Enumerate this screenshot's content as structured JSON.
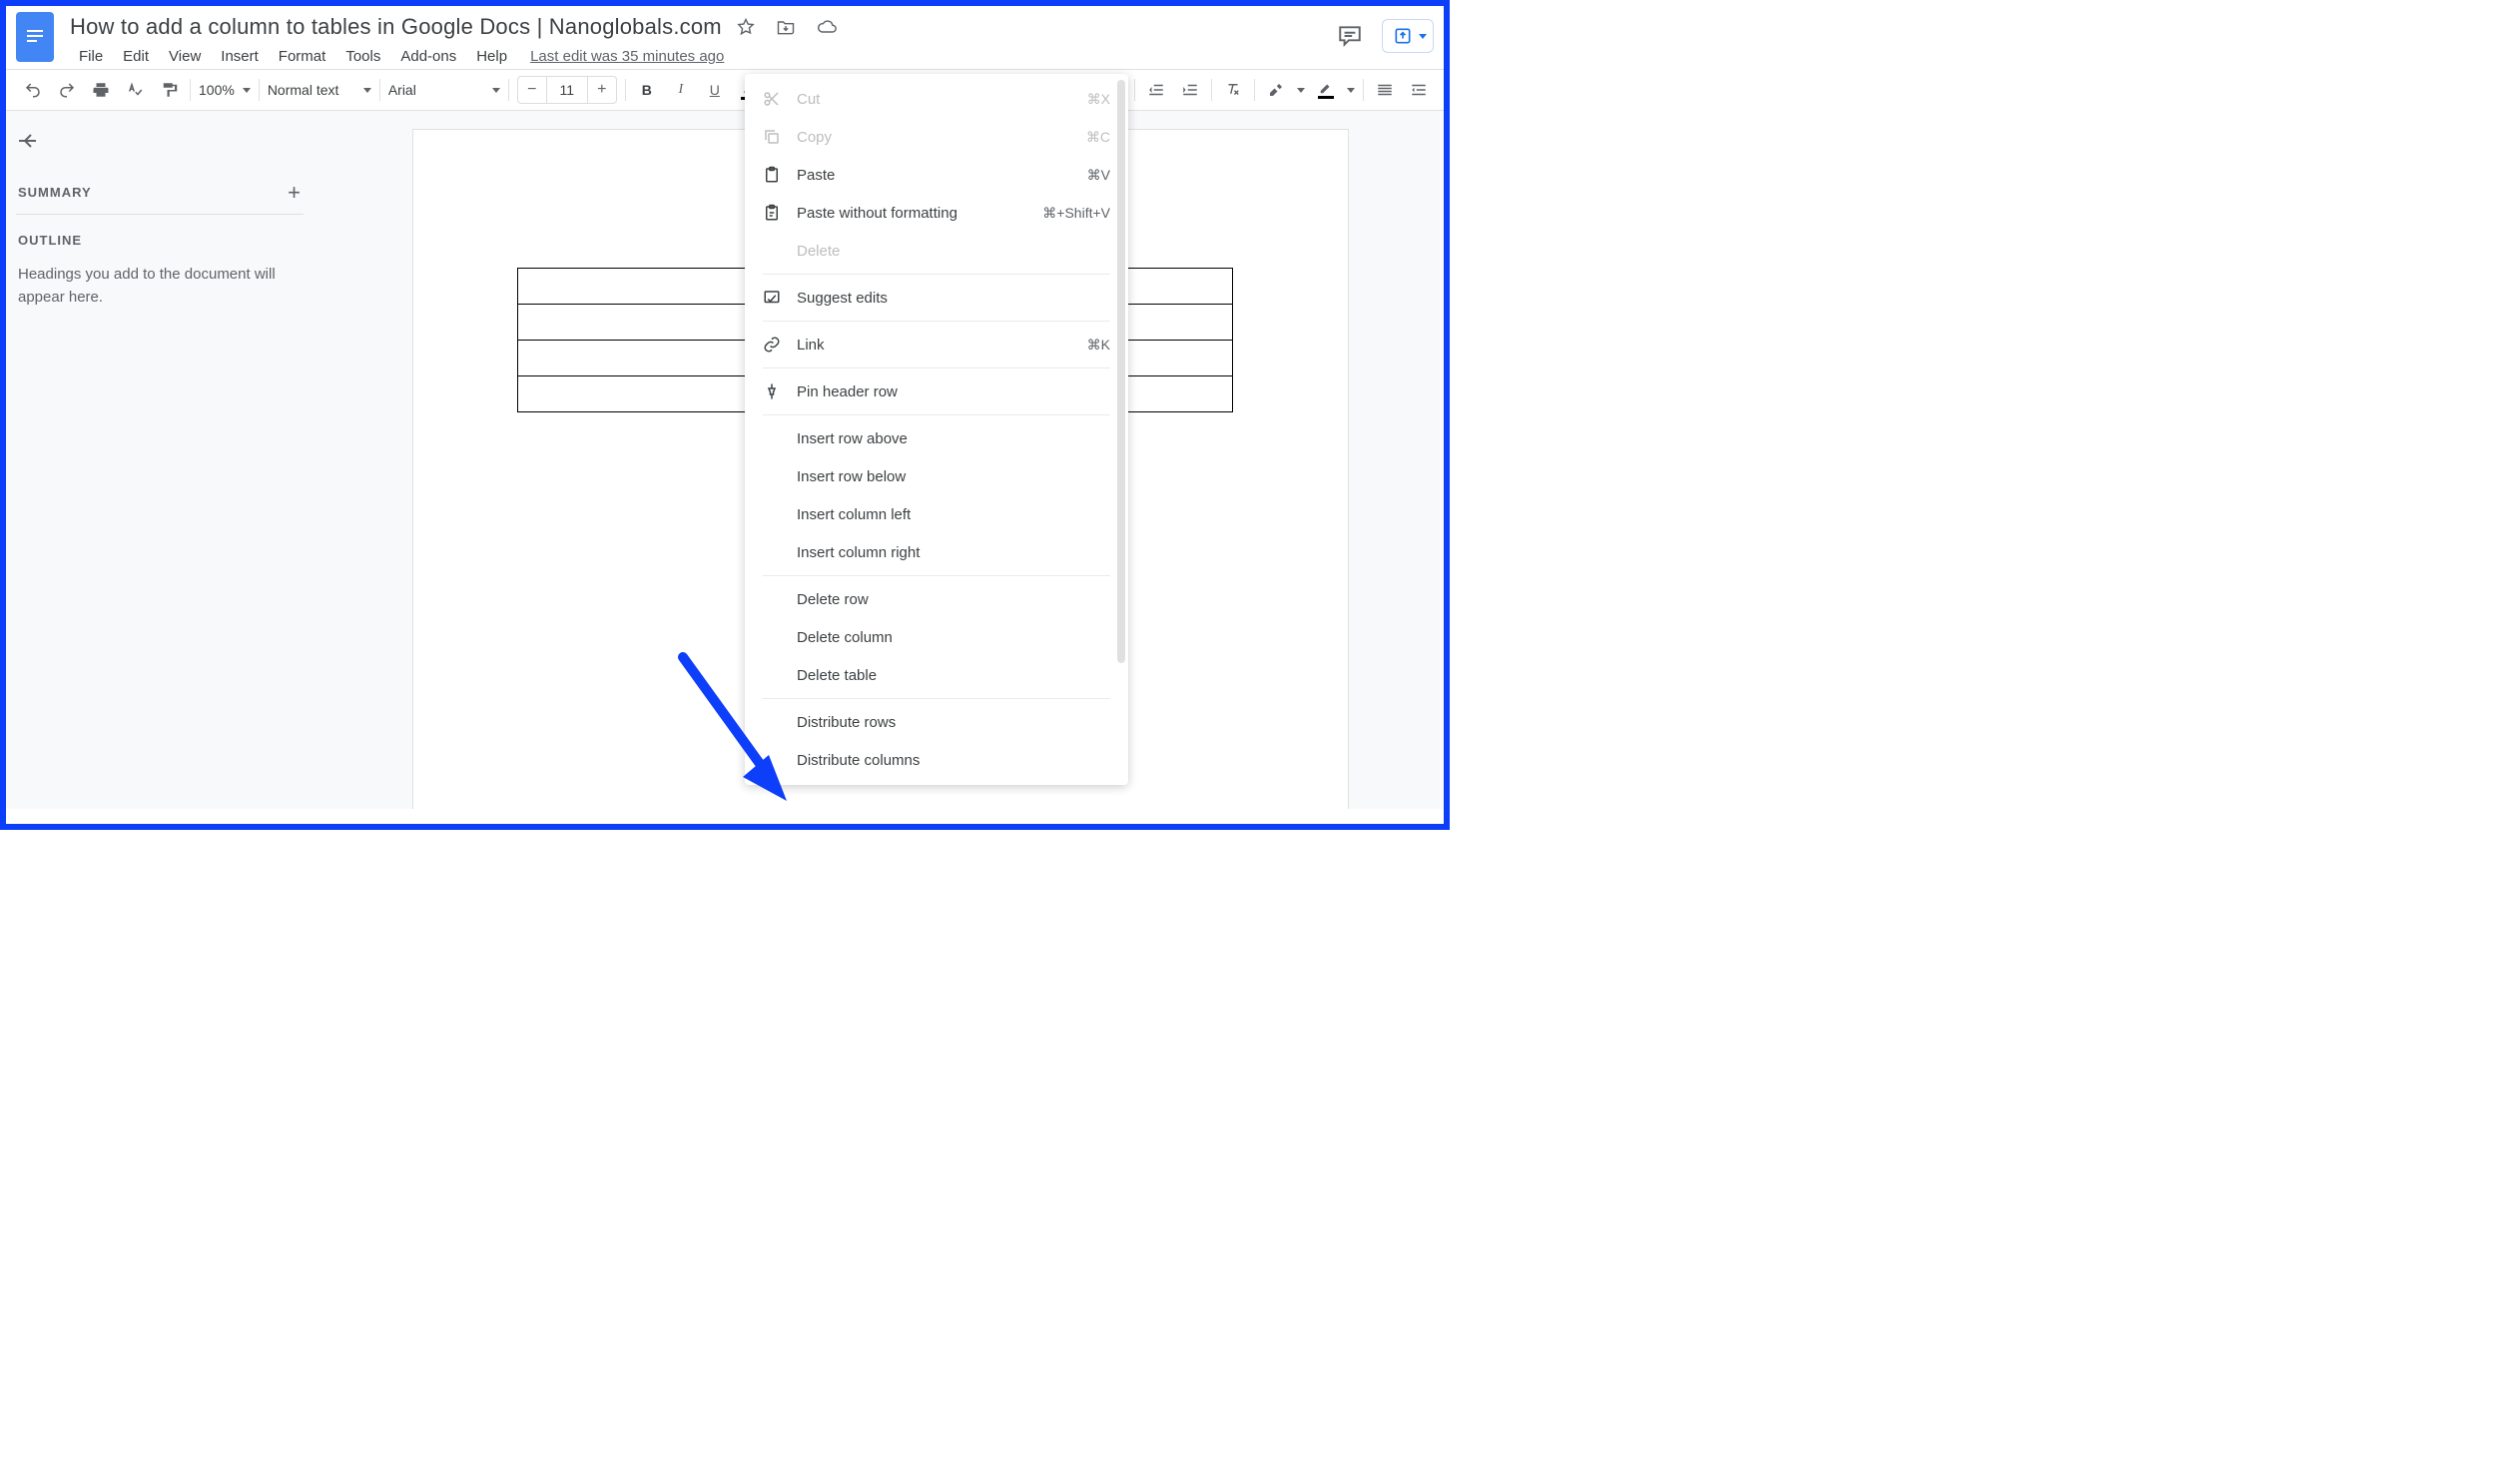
{
  "header": {
    "title": "How to add a column to tables in Google Docs | Nanoglobals.com",
    "menus": [
      "File",
      "Edit",
      "View",
      "Insert",
      "Format",
      "Tools",
      "Add-ons",
      "Help"
    ],
    "last_edit": "Last edit was 35 minutes ago"
  },
  "toolbar": {
    "zoom": "100%",
    "style": "Normal text",
    "font": "Arial",
    "font_size": "11"
  },
  "sidebar": {
    "summary_label": "SUMMARY",
    "outline_label": "OUTLINE",
    "outline_help": "Headings you add to the document will appear here."
  },
  "table": {
    "rows": 4,
    "cols": 3
  },
  "context_menu": {
    "items": [
      {
        "id": "cut",
        "label": "Cut",
        "shortcut": "⌘X",
        "icon": "cut",
        "disabled": true
      },
      {
        "id": "copy",
        "label": "Copy",
        "shortcut": "⌘C",
        "icon": "copy",
        "disabled": true
      },
      {
        "id": "paste",
        "label": "Paste",
        "shortcut": "⌘V",
        "icon": "paste",
        "disabled": false
      },
      {
        "id": "paste-nofmt",
        "label": "Paste without formatting",
        "shortcut": "⌘+Shift+V",
        "icon": "paste-nofmt",
        "disabled": false
      },
      {
        "id": "delete",
        "label": "Delete",
        "disabled": true,
        "noicon": true
      },
      {
        "sep": true
      },
      {
        "id": "suggest",
        "label": "Suggest edits",
        "icon": "suggest",
        "disabled": false
      },
      {
        "sep": true
      },
      {
        "id": "link",
        "label": "Link",
        "shortcut": "⌘K",
        "icon": "link",
        "disabled": false
      },
      {
        "sep": true
      },
      {
        "id": "pin-header",
        "label": "Pin header row",
        "icon": "pin",
        "disabled": false
      },
      {
        "sep": true
      },
      {
        "id": "row-above",
        "label": "Insert row above",
        "noicon": true
      },
      {
        "id": "row-below",
        "label": "Insert row below",
        "noicon": true
      },
      {
        "id": "col-left",
        "label": "Insert column left",
        "noicon": true
      },
      {
        "id": "col-right",
        "label": "Insert column right",
        "noicon": true
      },
      {
        "sep": true
      },
      {
        "id": "del-row",
        "label": "Delete row",
        "noicon": true
      },
      {
        "id": "del-col",
        "label": "Delete column",
        "noicon": true
      },
      {
        "id": "del-table",
        "label": "Delete table",
        "noicon": true
      },
      {
        "sep": true
      },
      {
        "id": "dist-rows",
        "label": "Distribute rows",
        "noicon": true
      },
      {
        "id": "dist-cols",
        "label": "Distribute columns",
        "noicon": true
      }
    ]
  }
}
